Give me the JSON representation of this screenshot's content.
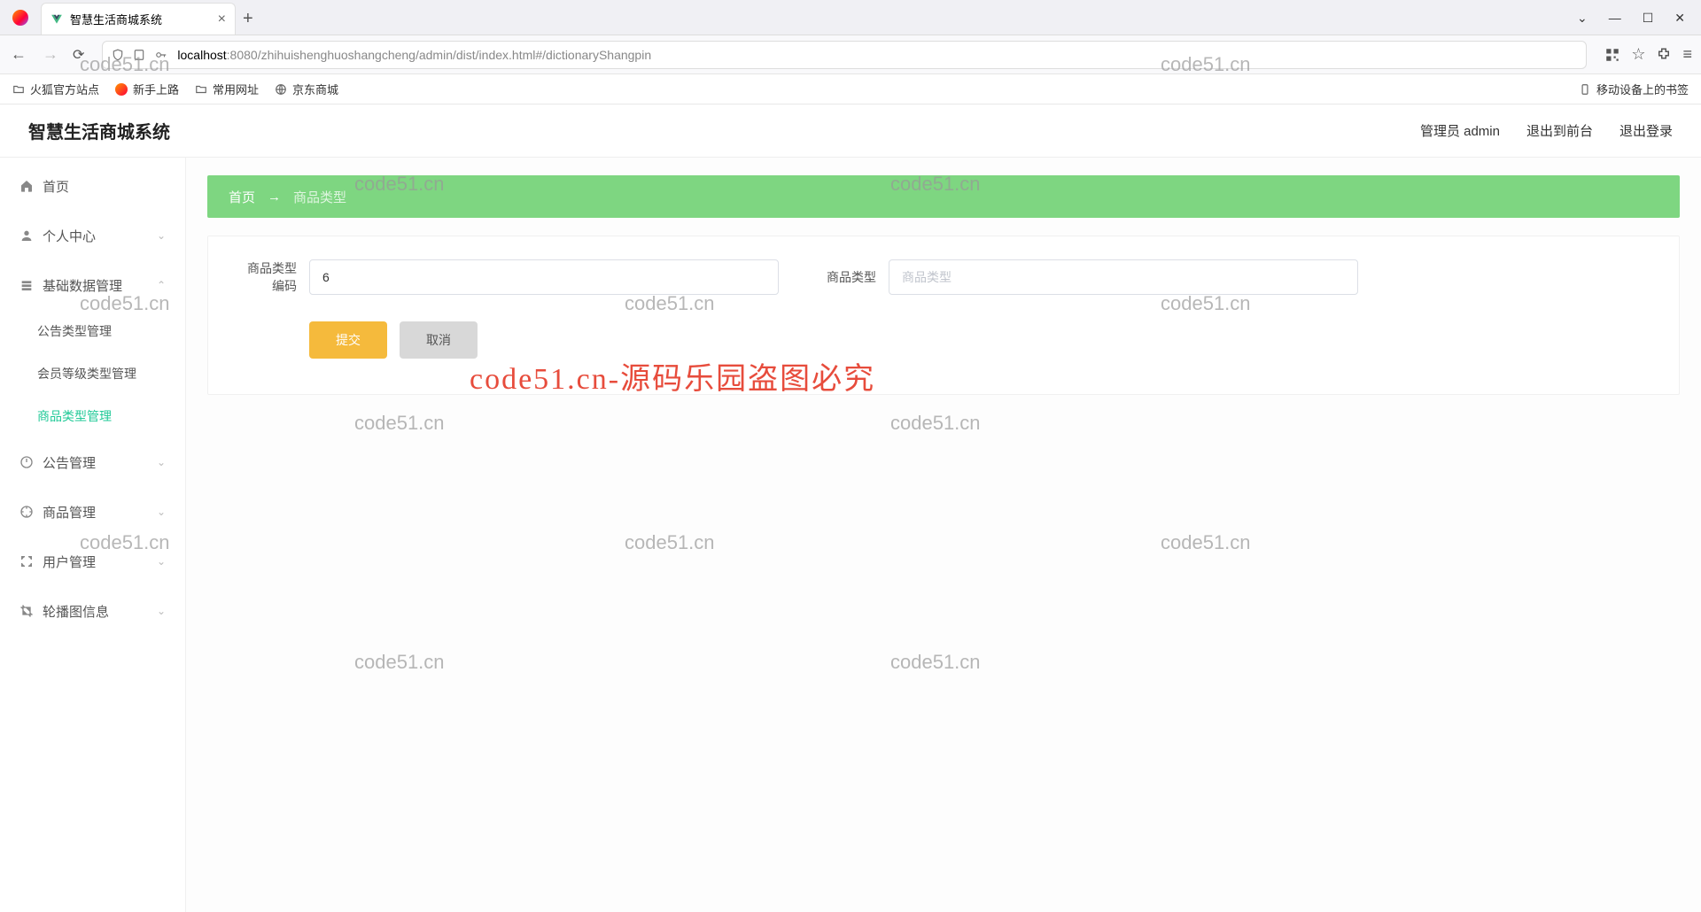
{
  "tab_title": "智慧生活商城系统",
  "url_bold": "localhost",
  "url_rest": ":8080/zhihuishenghuoshangcheng/admin/dist/index.html#/dictionaryShangpin",
  "bookmarks": {
    "b1": "火狐官方站点",
    "b2": "新手上路",
    "b3": "常用网址",
    "b4": "京东商城",
    "right": "移动设备上的书签"
  },
  "app_title": "智慧生活商城系统",
  "header": {
    "admin": "管理员 admin",
    "front": "退出到前台",
    "logout": "退出登录"
  },
  "sidebar": {
    "home": "首页",
    "personal": "个人中心",
    "basedata": "基础数据管理",
    "sub1": "公告类型管理",
    "sub2": "会员等级类型管理",
    "sub3": "商品类型管理",
    "notice": "公告管理",
    "product": "商品管理",
    "user": "用户管理",
    "carousel": "轮播图信息"
  },
  "breadcrumb": {
    "home": "首页",
    "arrow": "→",
    "current": "商品类型"
  },
  "form": {
    "label_code": "商品类型编码",
    "label_code_short": "商品类型",
    "code_value": "6",
    "label_name": "商品类型",
    "name_placeholder": "商品类型",
    "label_row2": "编码",
    "submit": "提交",
    "cancel": "取消"
  },
  "watermarks": [
    "code51.cn",
    "code51.cn",
    "code51.cn",
    "code51.cn",
    "code51.cn",
    "code51.cn",
    "code51.cn",
    "code51.cn",
    "code51.cn",
    "code51.cn",
    "code51.cn"
  ],
  "watermark_red": "code51.cn-源码乐园盗图必究"
}
